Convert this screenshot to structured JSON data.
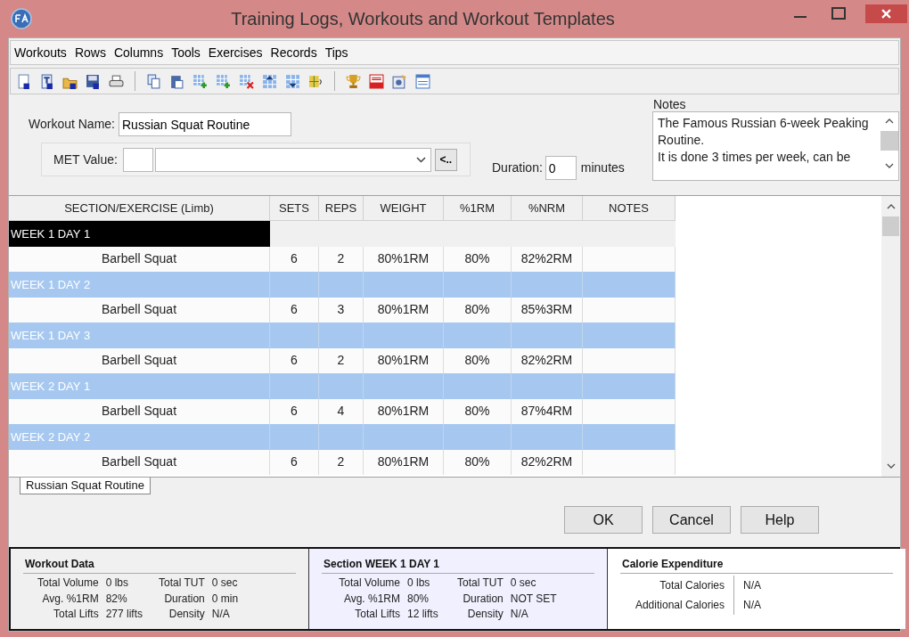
{
  "window": {
    "title": "Training Logs, Workouts and Workout Templates"
  },
  "menu": [
    "Workouts",
    "Rows",
    "Columns",
    "Tools",
    "Exercises",
    "Records",
    "Tips"
  ],
  "form": {
    "workout_name_label": "Workout Name:",
    "workout_name": "Russian Squat Routine",
    "met_label": "MET Value:",
    "met_button": "<..",
    "duration_label": "Duration:",
    "duration_value": "0",
    "duration_unit": "minutes",
    "notes_label": "Notes",
    "notes_lines": [
      "The Famous Russian 6-week Peaking Routine.",
      "It is done 3 times per week, can be"
    ]
  },
  "grid": {
    "columns": [
      "SECTION/EXERCISE (Limb)",
      "SETS",
      "REPS",
      "WEIGHT",
      "%1RM",
      "%NRM",
      "NOTES"
    ],
    "rows": [
      {
        "kind": "section",
        "label": "WEEK 1 DAY 1",
        "selected": true
      },
      {
        "kind": "exercise",
        "cells": [
          "Barbell Squat",
          "6",
          "2",
          "80%1RM",
          "80%",
          "82%2RM"
        ]
      },
      {
        "kind": "section",
        "label": "WEEK 1 DAY 2",
        "selected": false
      },
      {
        "kind": "exercise",
        "cells": [
          "Barbell Squat",
          "6",
          "3",
          "80%1RM",
          "80%",
          "85%3RM"
        ]
      },
      {
        "kind": "section",
        "label": "WEEK 1 DAY 3",
        "selected": false
      },
      {
        "kind": "exercise",
        "cells": [
          "Barbell Squat",
          "6",
          "2",
          "80%1RM",
          "80%",
          "82%2RM"
        ]
      },
      {
        "kind": "section",
        "label": "WEEK 2 DAY 1",
        "selected": false
      },
      {
        "kind": "exercise",
        "cells": [
          "Barbell Squat",
          "6",
          "4",
          "80%1RM",
          "80%",
          "87%4RM"
        ]
      },
      {
        "kind": "section",
        "label": "WEEK 2 DAY 2",
        "selected": false
      },
      {
        "kind": "exercise",
        "cells": [
          "Barbell Squat",
          "6",
          "2",
          "80%1RM",
          "80%",
          "82%2RM"
        ]
      }
    ]
  },
  "tabs": [
    {
      "label": "Russian Squat Routine",
      "selected": true
    }
  ],
  "buttons": [
    "OK",
    "Cancel",
    "Help"
  ],
  "summary": [
    {
      "kind": "stats",
      "title": "Workout Data",
      "columns": [
        [
          {
            "label": "Total Volume",
            "value": "0 lbs"
          },
          {
            "label": "Avg. %1RM",
            "value": "82%"
          },
          {
            "label": "Total Lifts",
            "value": "277 lifts"
          }
        ],
        [
          {
            "label": "Total TUT",
            "value": "0 sec"
          },
          {
            "label": "Duration",
            "value": "0 min"
          },
          {
            "label": "Density",
            "value": "N/A"
          }
        ]
      ]
    },
    {
      "kind": "stats",
      "title": "Section WEEK 1 DAY 1",
      "columns": [
        [
          {
            "label": "Total Volume",
            "value": "0 lbs"
          },
          {
            "label": "Avg. %1RM",
            "value": "80%"
          },
          {
            "label": "Total Lifts",
            "value": "12 lifts"
          }
        ],
        [
          {
            "label": "Total TUT",
            "value": "0 sec"
          },
          {
            "label": "Duration",
            "value": "NOT SET"
          },
          {
            "label": "Density",
            "value": "N/A"
          }
        ]
      ]
    },
    {
      "kind": "calories",
      "title": "Calorie Expenditure",
      "columns": [
        [
          {
            "label": "Total Calories",
            "value": "N/A"
          },
          {
            "label": "Additional Calories",
            "value": "N/A"
          }
        ]
      ]
    }
  ]
}
